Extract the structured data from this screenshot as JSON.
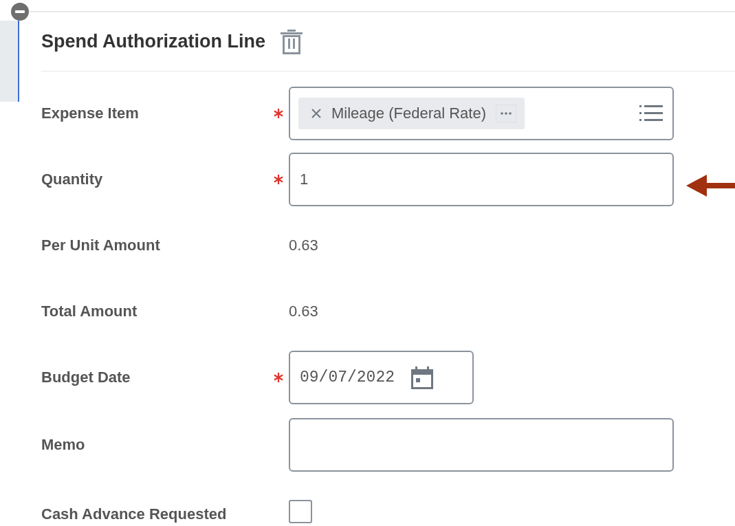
{
  "section": {
    "title": "Spend Authorization Line",
    "collapsed": false
  },
  "fields": [
    {
      "kind": "chip",
      "label": "Expense Item",
      "required": true,
      "value": "Mileage (Federal Rate)"
    },
    {
      "kind": "text",
      "label": "Quantity",
      "required": true,
      "value": "1",
      "annotated": true
    },
    {
      "kind": "readonly",
      "label": "Per Unit Amount",
      "required": false,
      "value": "0.63"
    },
    {
      "kind": "readonly",
      "label": "Total Amount",
      "required": false,
      "value": "0.63"
    },
    {
      "kind": "date",
      "label": "Budget Date",
      "required": true,
      "value": "09/07/2022"
    },
    {
      "kind": "textarea",
      "label": "Memo",
      "required": false
    },
    {
      "kind": "checkbox",
      "label": "Cash Advance Requested",
      "required": false,
      "checked": false
    }
  ]
}
